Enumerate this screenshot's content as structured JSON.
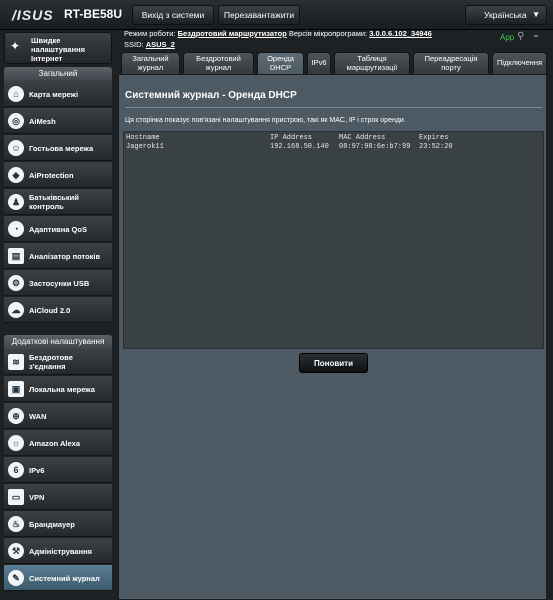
{
  "header": {
    "brand": "/ISUS",
    "model": "RT-BE58U",
    "logout_label": "Вихід з системи",
    "reboot_label": "Перезавантажити",
    "language": "Українська"
  },
  "info": {
    "mode_prefix": "Режим роботи:",
    "mode_value": "Бездротовий маршрутизатор",
    "firmware_prefix": "Версія мікропрограми:",
    "firmware_value": "3.0.0.6.102_34946",
    "ssid_prefix": "SSID:",
    "ssid_value": "ASUS_2",
    "app_label": "App"
  },
  "sidebar": {
    "quick_label": "Швидке налаштування Інтернет",
    "general_header": "Загальний",
    "general_items": [
      {
        "label": "Карта мережі"
      },
      {
        "label": "AiMesh"
      },
      {
        "label": "Гостьова мережа"
      },
      {
        "label": "AiProtection"
      },
      {
        "label": "Батьківський контроль"
      },
      {
        "label": "Адаптивна QoS"
      },
      {
        "label": "Аналізатор потоків"
      },
      {
        "label": "Застосунки USB"
      },
      {
        "label": "AiCloud 2.0"
      }
    ],
    "advanced_header": "Додаткові налаштування",
    "advanced_items": [
      {
        "label": "Бездротове з'єднання"
      },
      {
        "label": "Локальна мережа"
      },
      {
        "label": "WAN"
      },
      {
        "label": "Amazon Alexa"
      },
      {
        "label": "IPv6"
      },
      {
        "label": "VPN"
      },
      {
        "label": "Брандмауер"
      },
      {
        "label": "Адміністрування"
      },
      {
        "label": "Системний журнал"
      }
    ]
  },
  "tabs": [
    {
      "label": "Загальний журнал"
    },
    {
      "label": "Бездротовий журнал"
    },
    {
      "label": "Оренда DHCP"
    },
    {
      "label": "IPv6"
    },
    {
      "label": "Таблиця маршрутизації"
    },
    {
      "label": "Переадресація порту"
    },
    {
      "label": "Підключення"
    }
  ],
  "main": {
    "title": "Системний журнал - Оренда DHCP",
    "description": "Ця сторінка показує пов'язані налаштування пристрою, такі як MAC, IP і строк оренди.",
    "columns": [
      "Hostname",
      "IP Address",
      "MAC Address",
      "Expires"
    ],
    "rows": [
      [
        "Jagerok11",
        "192.168.50.140",
        "08:97:98:6e:b7:99",
        "23:52:20"
      ]
    ],
    "refresh_label": "Поновити"
  }
}
